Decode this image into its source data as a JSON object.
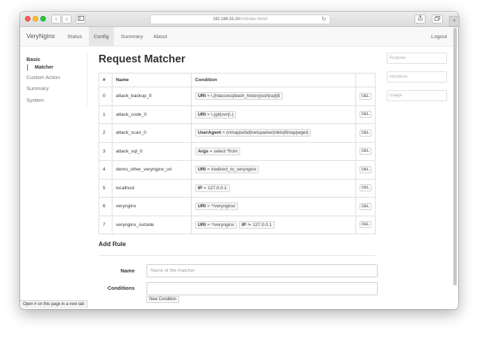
{
  "browser": {
    "url_host": "192.168.33.10",
    "url_path": "/vn/index.html#",
    "back": "‹",
    "forward": "›",
    "reload": "↻",
    "new_tab": "+"
  },
  "navbar": {
    "brand": "VeryNginx",
    "links": [
      "Status",
      "Config",
      "Summary",
      "About"
    ],
    "active": "Config",
    "logout": "Logout"
  },
  "sidebar": {
    "section": "Basic",
    "sub_item": "Matcher",
    "items": [
      "Custom Action",
      "Summary",
      "System"
    ]
  },
  "page": {
    "title": "Request Matcher"
  },
  "table": {
    "headers": [
      "#",
      "Name",
      "Condition"
    ],
    "del_label": "DEL",
    "rows": [
      {
        "idx": "0",
        "name": "attack_backup_0",
        "conds": [
          {
            "key": "URI",
            "op": "≈",
            "val": "\\.(htaccess|bash_history|ssh|sql)$"
          }
        ]
      },
      {
        "idx": "1",
        "name": "attack_code_0",
        "conds": [
          {
            "key": "URI",
            "op": "≈",
            "val": "\\.(git|svn|\\.)"
          }
        ]
      },
      {
        "idx": "2",
        "name": "attack_scan_0",
        "conds": [
          {
            "key": "UserAgent",
            "op": "≈",
            "val": "(nmap|w3af|netsparker|nikto|fimap|wget)"
          }
        ]
      },
      {
        "idx": "3",
        "name": "attack_sql_0",
        "conds": [
          {
            "key": "Args",
            "op": "≈",
            "val": "select.*from"
          }
        ]
      },
      {
        "idx": "4",
        "name": "demo_other_verynginx_uri",
        "conds": [
          {
            "key": "URI",
            "op": "=",
            "val": "/redirect_to_verynginx"
          }
        ]
      },
      {
        "idx": "5",
        "name": "localhost",
        "conds": [
          {
            "key": "IP",
            "op": "=",
            "val": "127.0.0.1"
          }
        ]
      },
      {
        "idx": "6",
        "name": "verynginx",
        "conds": [
          {
            "key": "URI",
            "op": "≈",
            "val": "^/verynginx/"
          }
        ]
      },
      {
        "idx": "7",
        "name": "verynginx_outside",
        "conds": [
          {
            "key": "URI",
            "op": "≈",
            "val": "^/verynginx"
          },
          {
            "key": "IP",
            "op": "!=",
            "val": "127.0.0.1"
          }
        ]
      }
    ]
  },
  "add_rule": {
    "title": "Add Rule",
    "name_label": "Name",
    "name_placeholder": "Name of the matcher",
    "conditions_label": "Conditions",
    "new_condition": "New Condition"
  },
  "right_inputs": {
    "purpose_placeholder": "Purpose",
    "introduce_placeholder": "Introduce",
    "usage_placeholder": "Usage"
  },
  "status_bar": "Open # on this page in a new tab"
}
